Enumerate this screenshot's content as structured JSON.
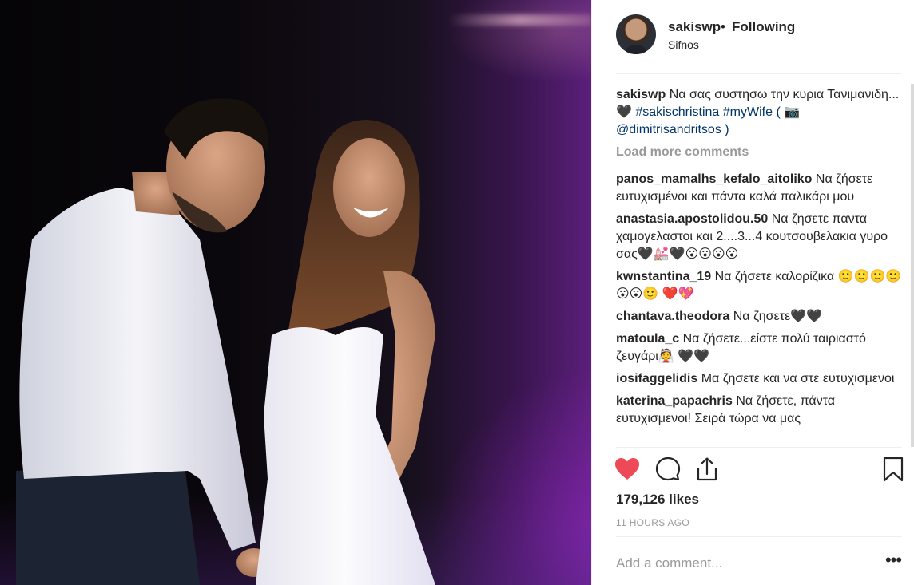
{
  "post": {
    "header": {
      "username": "sakiswp",
      "separator": "•",
      "follow_state": "Following",
      "location": "Sifnos"
    },
    "caption": {
      "username": "sakiswp",
      "text_1": "Να σας συστησω την κυρια Τανιμανιδη... ",
      "heart": "🖤",
      "hashtag_1": "#sakischristina",
      "hashtag_2": "#myWife",
      "text_2": " ( ",
      "camera": "📷",
      "mention": "@dimitrisandritsos",
      "text_3": " )"
    },
    "load_more_label": "Load more comments",
    "comments": [
      {
        "user": "panos_mamalhs_kefalo_aitoliko",
        "text": "Να ζήσετε ευτυχισμένοι και πάντα καλά παλικάρι μου"
      },
      {
        "user": "anastasia.apostolidou.50",
        "text": "Να ζησετε παντα χαμογελαστοι και 2....3...4 κουτσουβελακια γυρο σας🖤💒🖤😮😮😮😮"
      },
      {
        "user": "kwnstantina_19",
        "text": "Να ζήσετε καλορίζικα 🙂🙂🙂🙂😮😮🙂 ❤️💖"
      },
      {
        "user": "chantava.theodora",
        "text": "Να ζησετε🖤🖤"
      },
      {
        "user": "matoula_c",
        "text": "Να ζήσετε...είστε πολύ ταιριαστό ζευγάρι👰 🖤🖤"
      },
      {
        "user": "iosifaggelidis",
        "text": "Μα ζησετε και να στε ευτυχισμενοι"
      },
      {
        "user": "katerina_papachris",
        "text": "Να ζήσετε, πάντα ευτυχισμενοι! Σειρά τώρα να μας"
      }
    ],
    "icons": {
      "like": "heart-filled-icon",
      "comment": "comment-bubble-icon",
      "share": "share-icon",
      "save": "bookmark-icon",
      "more": "more-options-icon"
    },
    "colors": {
      "like_red": "#ed4956",
      "hashtag_blue": "#003569",
      "muted_gray": "#999999",
      "text": "#262626"
    },
    "likes_label": "179,126 likes",
    "time_label": "11 HOURS AGO",
    "add_comment_placeholder": "Add a comment...",
    "more_label": "•••"
  }
}
